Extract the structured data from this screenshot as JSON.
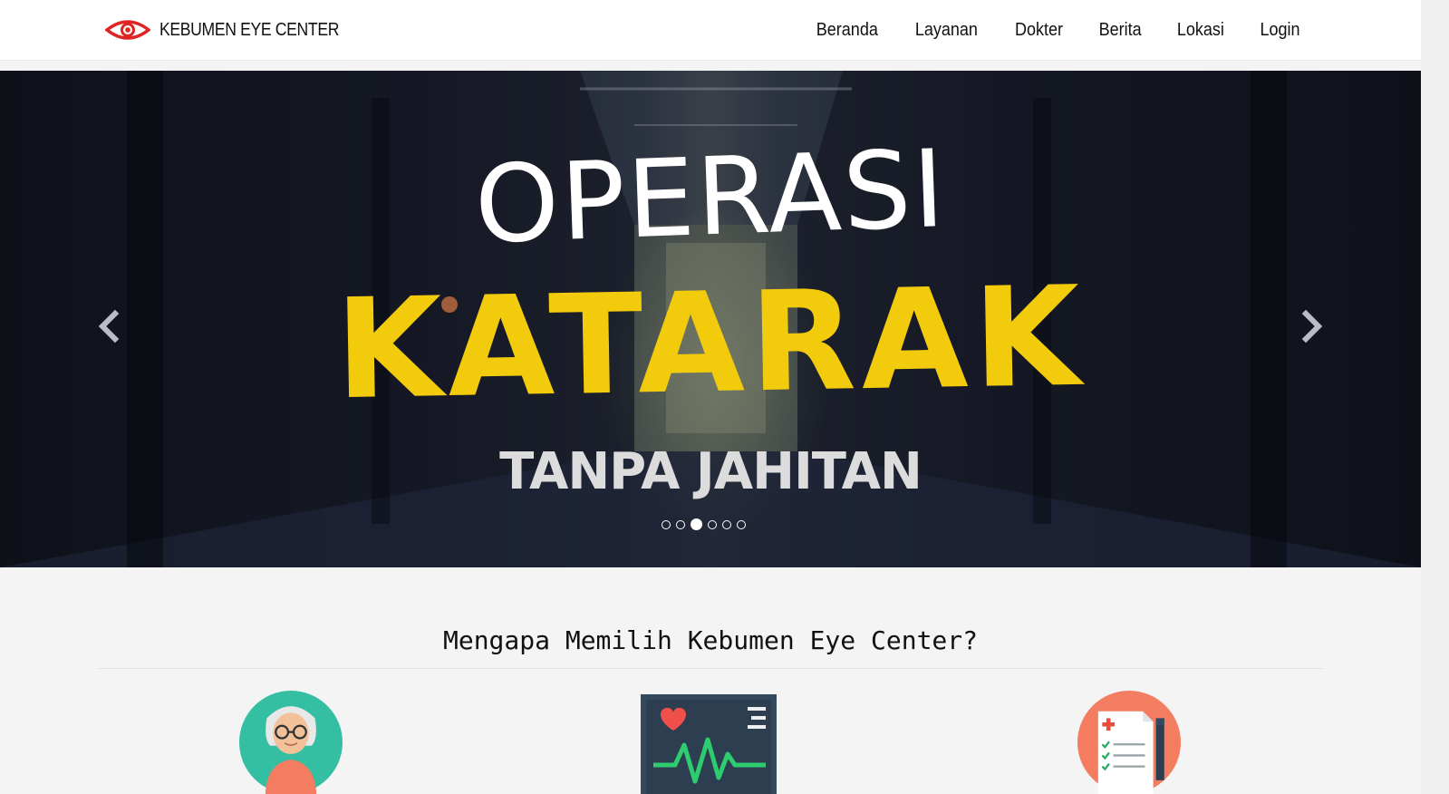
{
  "navbar": {
    "brand": "KEBUMEN EYE CENTER",
    "brand_logo_icon": "eye-icon",
    "links": [
      "Beranda",
      "Layanan",
      "Dokter",
      "Berita",
      "Lokasi",
      "Login"
    ]
  },
  "hero": {
    "line1": "OPERASI",
    "line2": "KATARAK",
    "line3": "TANPA JAHITAN",
    "active_slide": 3,
    "slide_count": 6,
    "prev_icon": "chevron-left-icon",
    "next_icon": "chevron-right-icon"
  },
  "section": {
    "title": "Mengapa Memilih Kebumen Eye Center?",
    "features": [
      {
        "icon": "elderly-person-icon",
        "color": "#34bfa3"
      },
      {
        "icon": "heart-monitor-icon",
        "color": "#34495e"
      },
      {
        "icon": "medical-checklist-icon",
        "color": "#f47c60"
      }
    ]
  },
  "colors": {
    "accent_red": "#e02323",
    "hero_yellow": "#f3cb0d"
  }
}
